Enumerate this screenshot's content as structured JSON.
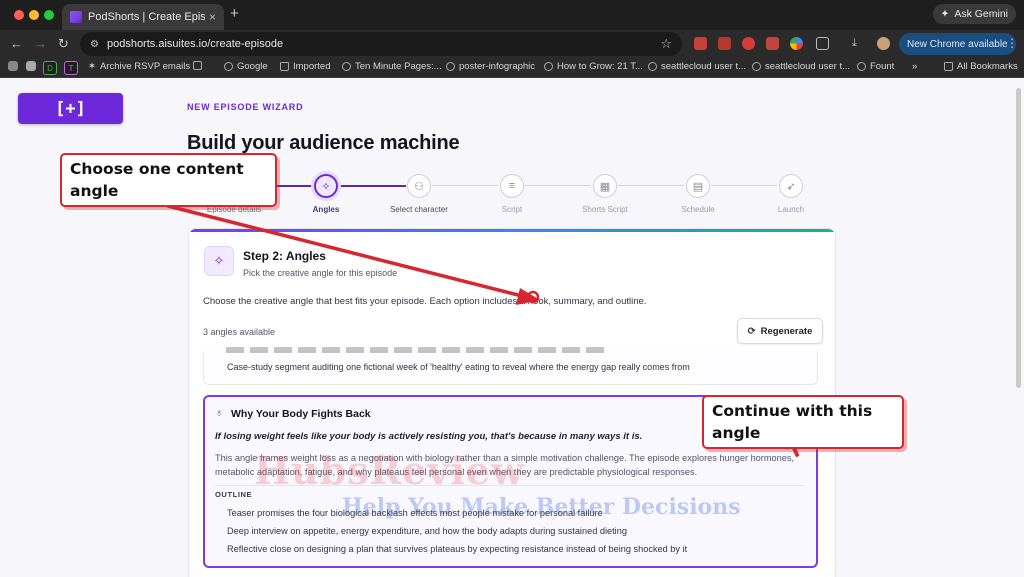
{
  "browser": {
    "tab_title": "PodShorts | Create Episode",
    "tab_close": "×",
    "new_tab": "+",
    "ask_gemini": "Ask Gemini",
    "url": "podshorts.aisuites.io/create-episode",
    "new_chrome": "New Chrome available",
    "bookmarks": [
      "Archive RSVP emails",
      "Google",
      "Imported",
      "Ten Minute Pages:...",
      "poster-infographic",
      "How to Grow: 21 T...",
      "seattlecloud user t...",
      "seattlecloud user t...",
      "Fount",
      "All Bookmarks"
    ],
    "bookmark_tiles": [
      "D",
      "T"
    ],
    "more_chevron": "»"
  },
  "page": {
    "logo_text": "[+]",
    "eyebrow": "NEW EPISODE WIZARD",
    "title": "Build your audience machine",
    "steps": [
      "Episode details",
      "Angles",
      "Select character",
      "Script",
      "Shorts Script",
      "Schedule",
      "Launch"
    ],
    "card": {
      "heading": "Step 2: Angles",
      "subheading": "Pick the creative angle for this episode",
      "description": "Choose the creative angle that best fits your episode. Each option includes a hook, summary, and outline.",
      "count": "3 angles available",
      "regenerate": "Regenerate",
      "angle1_item": "Case-study segment auditing one fictional week of 'healthy' eating to reveal where the energy gap really comes from",
      "angle2": {
        "title": "Why Your Body Fights Back",
        "hook": "If losing weight feels like your body is actively resisting you, that's because in many ways it is.",
        "summary": "This angle frames weight loss as a negotiation with biology rather than a simple motivation challenge. The episode explores hunger hormones, metabolic adaptation, fatigue, and why plateaus feel personal even when they are predictable physiological responses.",
        "outline_label": "OUTLINE",
        "outline": [
          "Teaser promises the four biological backlash effects most people mistake for personal failure",
          "Deep interview on appetite, energy expenditure, and how the body adapts during sustained dieting",
          "Reflective close on designing a plan that survives plateaus by expecting resistance instead of being shocked by it"
        ]
      }
    }
  },
  "watermark": {
    "line1": "HubsReview",
    "line2": "Help You Make Better Decisions"
  },
  "annotations": {
    "callout1": "Choose one content angle",
    "callout2": "Continue with this angle"
  },
  "colors": {
    "accent": "#6d28d9",
    "annotation_red": "#d7262e"
  }
}
